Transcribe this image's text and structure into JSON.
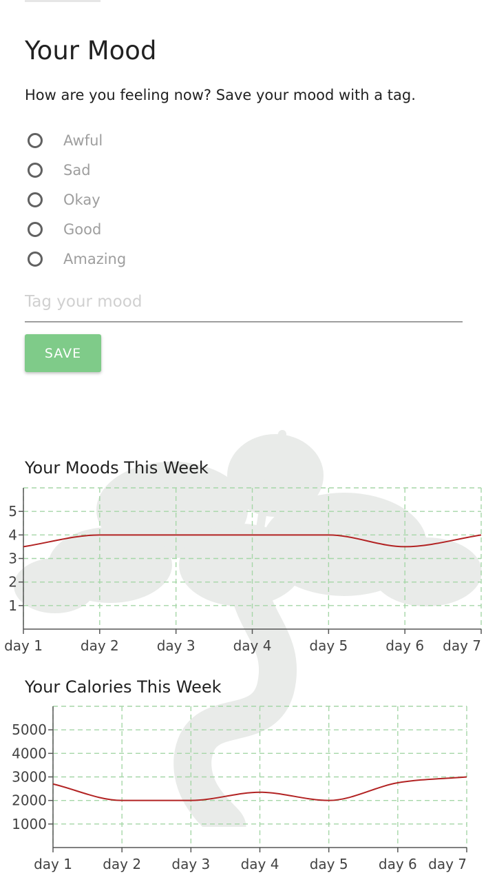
{
  "mood_form": {
    "title": "Your Mood",
    "subtitle": "How are you feeling now? Save your mood with a tag.",
    "options": [
      {
        "label": "Awful"
      },
      {
        "label": "Sad"
      },
      {
        "label": "Okay"
      },
      {
        "label": "Good"
      },
      {
        "label": "Amazing"
      }
    ],
    "tag_placeholder": "Tag your mood",
    "tag_value": "",
    "save_label": "SAVE"
  },
  "colors": {
    "accent_button": "#7fcb89",
    "grid": "#a5d6a7",
    "line": "#b22222"
  },
  "chart_data": [
    {
      "type": "line",
      "title": "Your Moods This Week",
      "xlabel": "",
      "ylabel": "",
      "categories": [
        "day 1",
        "day 2",
        "day 3",
        "day 4",
        "day 5",
        "day 6",
        "day 7"
      ],
      "series": [
        {
          "values": [
            3.5,
            4,
            4,
            4,
            4,
            3.5,
            4
          ]
        }
      ],
      "ylim": [
        0,
        6
      ],
      "yticks": [
        1,
        2,
        3,
        4,
        5
      ],
      "grid": true,
      "grid_style": "dashed"
    },
    {
      "type": "line",
      "title": "Your Calories This Week",
      "xlabel": "",
      "ylabel": "",
      "categories": [
        "day 1",
        "day 2",
        "day 3",
        "day 4",
        "day 5",
        "day 6",
        "day 7"
      ],
      "series": [
        {
          "values": [
            2700,
            2000,
            2000,
            2350,
            2000,
            2750,
            3000
          ]
        }
      ],
      "ylim": [
        0,
        6000
      ],
      "yticks": [
        1000,
        2000,
        3000,
        4000,
        5000
      ],
      "grid": true,
      "grid_style": "dashed"
    }
  ]
}
